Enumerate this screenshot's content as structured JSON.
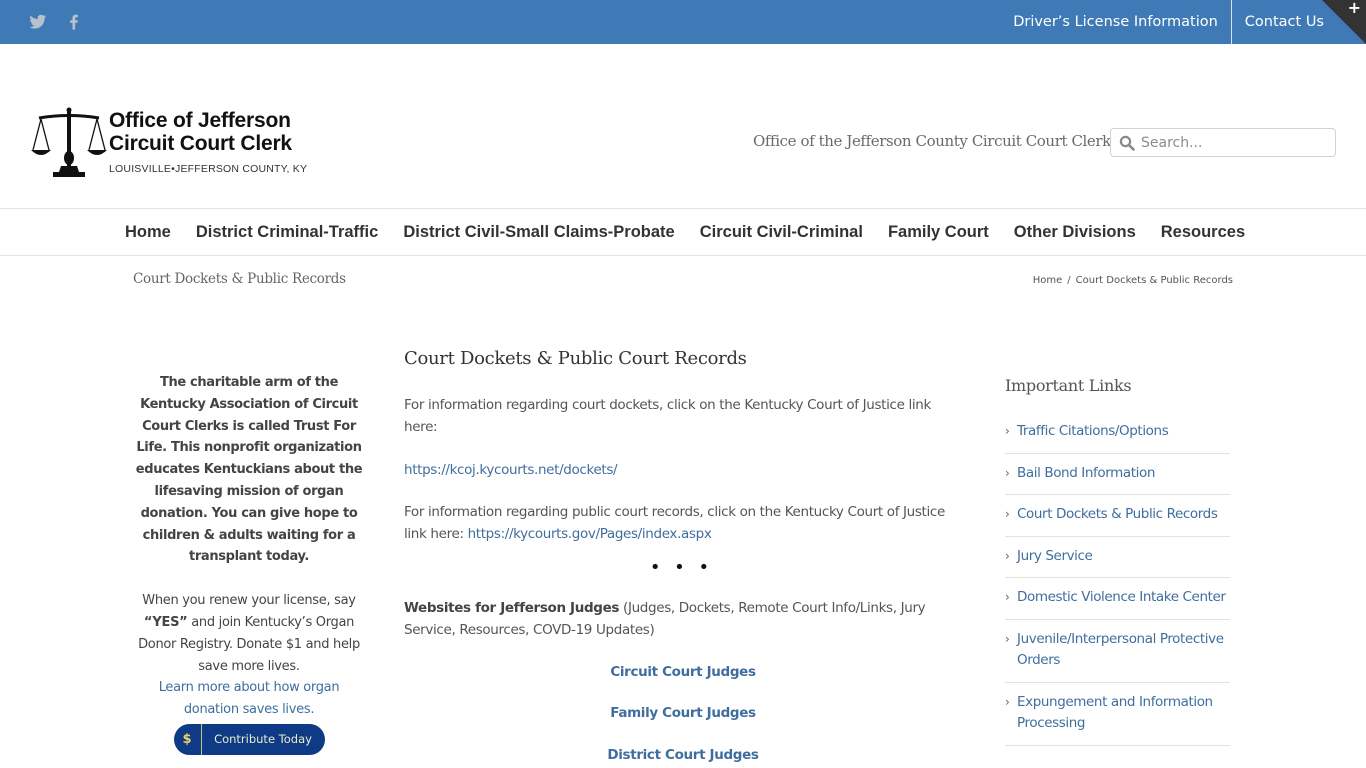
{
  "topbar": {
    "social": [
      {
        "name": "twitter-icon"
      },
      {
        "name": "facebook-icon"
      }
    ],
    "links": [
      {
        "label": "Driver’s License Information"
      },
      {
        "label": "Contact Us"
      }
    ],
    "corner_symbol": "+"
  },
  "header": {
    "logo": {
      "title_line1": "Office of Jefferson",
      "title_line2": "Circuit Court Clerk",
      "subtitle": "LOUISVILLE•JEFFERSON COUNTY, KY"
    },
    "tagline": "Office of the Jefferson County Circuit Court Clerk",
    "search": {
      "placeholder": "Search...",
      "value": ""
    }
  },
  "nav": {
    "items": [
      {
        "label": "Home"
      },
      {
        "label": "District Criminal-Traffic"
      },
      {
        "label": "District Civil-Small Claims-Probate"
      },
      {
        "label": "Circuit Civil-Criminal"
      },
      {
        "label": "Family Court"
      },
      {
        "label": "Other Divisions"
      },
      {
        "label": "Resources"
      }
    ]
  },
  "page_title_bar": {
    "title": "Court Dockets & Public Records",
    "breadcrumb": {
      "home": "Home",
      "separator": "/",
      "current": "Court Dockets & Public Records"
    }
  },
  "left_sidebar": {
    "bold_text": "The charitable arm of the Kentucky Association of Circuit Court Clerks is called Trust For Life. This nonprofit organization educates Kentuckians about the lifesaving mission of organ donation. You can give hope to children & adults waiting for a transplant today.",
    "renew_prefix": "When you renew your license, say ",
    "renew_yes": "“YES”",
    "renew_suffix": " and join Kentucky’s Organ Donor Registry. Donate $1 and help save more lives.",
    "learn_more": "Learn more about how organ donation saves lives.",
    "contribute": {
      "symbol": "$",
      "label": "Contribute Today"
    }
  },
  "content": {
    "heading": "Court Dockets & Public Court Records",
    "p1": "For information regarding court dockets, click on the Kentucky Court of Justice link here:",
    "link1": "https://kcoj.kycourts.net/dockets/",
    "p2_prefix": "For information regarding public court records, click on the Kentucky Court of Justice link here: ",
    "link2": "https://kycourts.gov/Pages/index.aspx",
    "dots": "• • •",
    "judges_bold": "Websites for Jefferson Judges",
    "judges_rest": " (Judges, Dockets, Remote Court Info/Links, Jury Service, Resources, COVD-19 Updates)",
    "judge_links": [
      {
        "label": "Circuit Court Judges"
      },
      {
        "label": "Family Court Judges"
      },
      {
        "label": "District Court Judges"
      }
    ]
  },
  "right_sidebar": {
    "heading": "Important Links",
    "chevron": "›",
    "links": [
      {
        "label": "Traffic Citations/Options"
      },
      {
        "label": "Bail Bond Information"
      },
      {
        "label": "Court Dockets & Public Records"
      },
      {
        "label": "Jury Service"
      },
      {
        "label": "Domestic Violence Intake Center"
      },
      {
        "label": "Juvenile/Interpersonal Protective Orders"
      },
      {
        "label": "Expungement and Information Processing"
      }
    ]
  }
}
